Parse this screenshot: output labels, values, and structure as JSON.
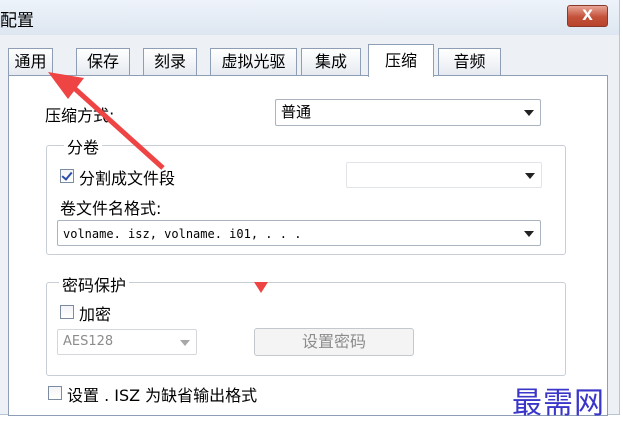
{
  "window": {
    "title": "配置",
    "close_label": "X"
  },
  "tabs": [
    {
      "label": "通用",
      "active": false
    },
    {
      "label": "保存",
      "active": false
    },
    {
      "label": "刻录",
      "active": false
    },
    {
      "label": "虚拟光驱",
      "active": false
    },
    {
      "label": "集成",
      "active": false
    },
    {
      "label": "压缩",
      "active": true
    },
    {
      "label": "音频",
      "active": false
    }
  ],
  "compression": {
    "method_label": "压缩方式:",
    "method_value": "普通"
  },
  "split": {
    "group_label": "分卷",
    "split_checkbox_label": "分割成文件段",
    "split_checked": true,
    "size_value": "",
    "name_format_label": "卷文件名格式:",
    "name_format_value": "volname. isz, volname. i01, . . ."
  },
  "password": {
    "group_label": "密码保护",
    "encrypt_label": "加密",
    "encrypt_checked": false,
    "algorithm_value": "AES128",
    "set_password_label": "设置密码"
  },
  "default_format": {
    "label": "设置 . ISZ 为缺省输出格式",
    "checked": false
  },
  "watermark": "最需网",
  "colors": {
    "annotation_red": "#ee4444",
    "watermark_blue": "#3a36c9",
    "disabled_text": "#8c8c8c"
  }
}
